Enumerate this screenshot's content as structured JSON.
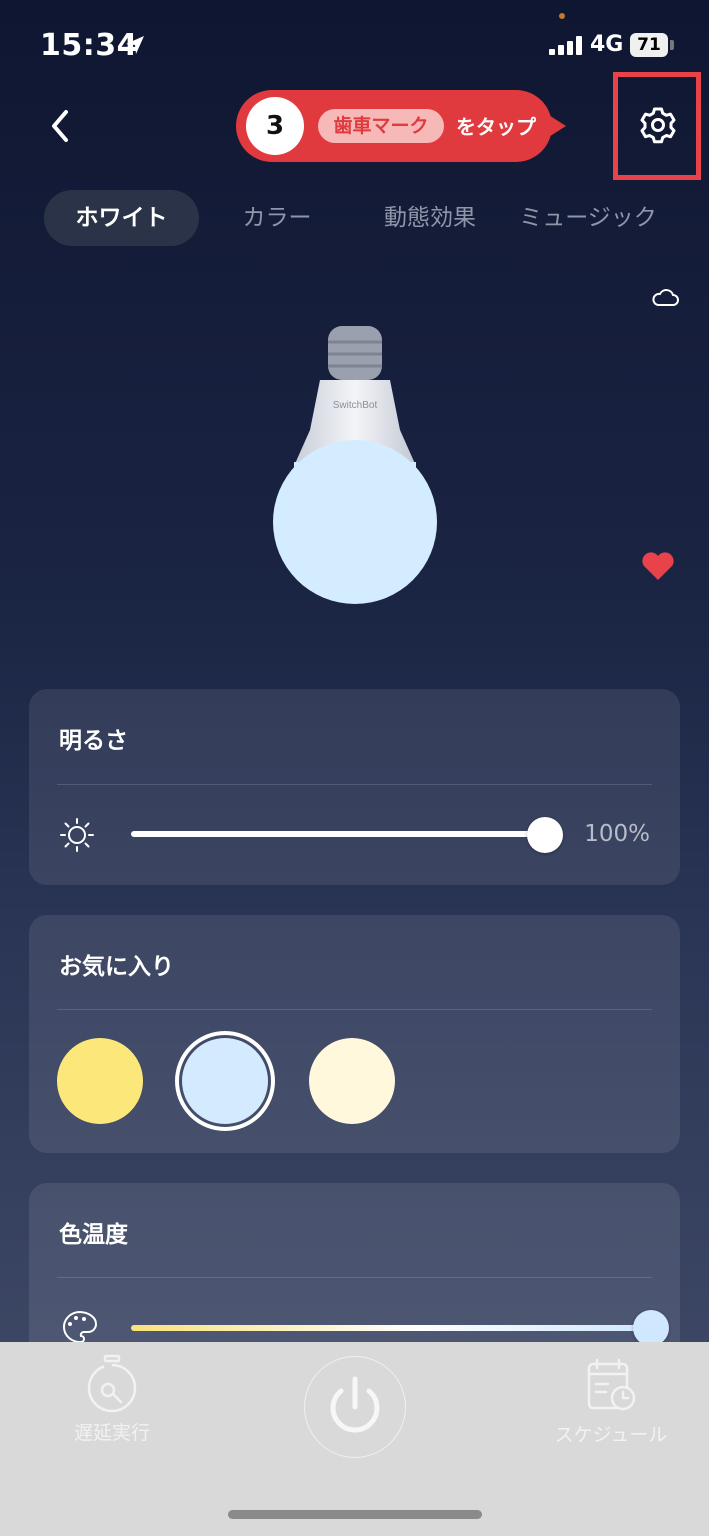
{
  "status_bar": {
    "time": "15:34",
    "network": "4G",
    "battery": "71"
  },
  "header": {
    "back_icon": "chevron-left-icon",
    "settings_icon": "gear-icon",
    "instruction_banner": {
      "step": "3",
      "highlight": "歯車マーク",
      "text": "をタップ",
      "color": "#e13a3e"
    }
  },
  "tabs": [
    {
      "label": "ホワイト",
      "active": true
    },
    {
      "label": "カラー",
      "active": false
    },
    {
      "label": "動態効果",
      "active": false
    },
    {
      "label": "ミュージック",
      "active": false
    }
  ],
  "bulb": {
    "brand": "SwitchBot",
    "light_color": "#d4ecff"
  },
  "brightness": {
    "title": "明るさ",
    "value": "100%",
    "level": 1.0
  },
  "favorites": {
    "title": "お気に入り",
    "colors": [
      "#fce87a",
      "#d4ebff",
      "#fff8dc"
    ],
    "selected_index": 1
  },
  "color_temperature": {
    "title": "色温度",
    "level": 1.0
  },
  "bottom_bar": {
    "delay_label": "遅延実行",
    "schedule_label": "スケジュール"
  },
  "colors": {
    "accent_red": "#e13a3e",
    "favorite_heart": "#e8424a"
  }
}
